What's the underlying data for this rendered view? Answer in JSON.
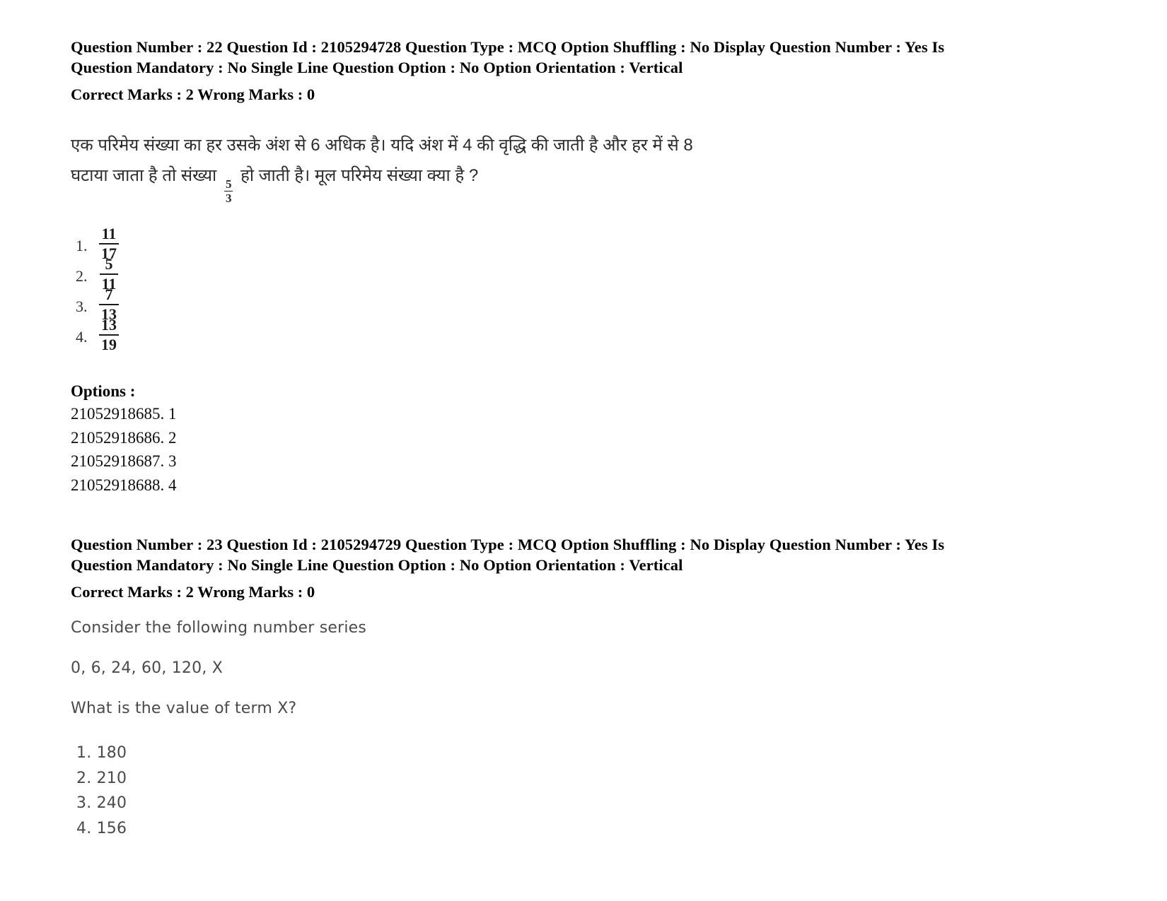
{
  "document": {
    "background_color": "#ffffff",
    "text_color": "#000000"
  },
  "questions": [
    {
      "meta_line_1": "Question Number : 22 Question Id : 2105294728 Question Type : MCQ Option Shuffling : No Display Question Number : Yes Is",
      "meta_line_2": "Question Mandatory : No Single Line Question Option : No Option Orientation : Vertical",
      "marks_line": "Correct Marks : 2 Wrong Marks : 0",
      "question_number": "22",
      "question_id": "2105294728",
      "question_type": "MCQ",
      "option_shuffling": "No",
      "display_question_number": "Yes",
      "is_question_mandatory": "No",
      "single_line_question_option": "No",
      "option_orientation": "Vertical",
      "correct_marks": "2",
      "wrong_marks": "0",
      "body_language": "hindi",
      "body_line_1_a": "एक परिमेय संख्या का हर उसके अंश से 6 अधिक है। यदि अंश में 4 की वृद्धि की जाती है और हर में से 8",
      "body_line_2_a": "घटाया जाता है तो संख्या",
      "body_inline_fraction": {
        "numerator": "5",
        "denominator": "3"
      },
      "body_line_2_b": "हो जाती है। मूल परिमेय संख्या क्या है ?",
      "answer_options": [
        {
          "index": "1.",
          "numerator": "11",
          "denominator": "17"
        },
        {
          "index": "2.",
          "numerator": "5",
          "denominator": "11"
        },
        {
          "index": "3.",
          "numerator": "7",
          "denominator": "13"
        },
        {
          "index": "4.",
          "numerator": "13",
          "denominator": "19"
        }
      ],
      "options_label": "Options :",
      "option_ids": [
        "21052918685. 1",
        "21052918686. 2",
        "21052918687. 3",
        "21052918688. 4"
      ]
    },
    {
      "meta_line_1": "Question Number : 23 Question Id : 2105294729 Question Type : MCQ Option Shuffling : No Display Question Number : Yes Is",
      "meta_line_2": "Question Mandatory : No Single Line Question Option : No Option Orientation : Vertical",
      "marks_line": "Correct Marks : 2 Wrong Marks : 0",
      "question_number": "23",
      "question_id": "2105294729",
      "question_type": "MCQ",
      "option_shuffling": "No",
      "display_question_number": "Yes",
      "is_question_mandatory": "No",
      "single_line_question_option": "No",
      "option_orientation": "Vertical",
      "correct_marks": "2",
      "wrong_marks": "0",
      "body_language": "english",
      "body_line_1": "Consider the following number series",
      "body_line_2": "0, 6, 24, 60, 120, X",
      "body_line_3": "What is the value of term X?",
      "answer_options": [
        "1. 180",
        "2. 210",
        "3. 240",
        "4. 156"
      ]
    }
  ]
}
